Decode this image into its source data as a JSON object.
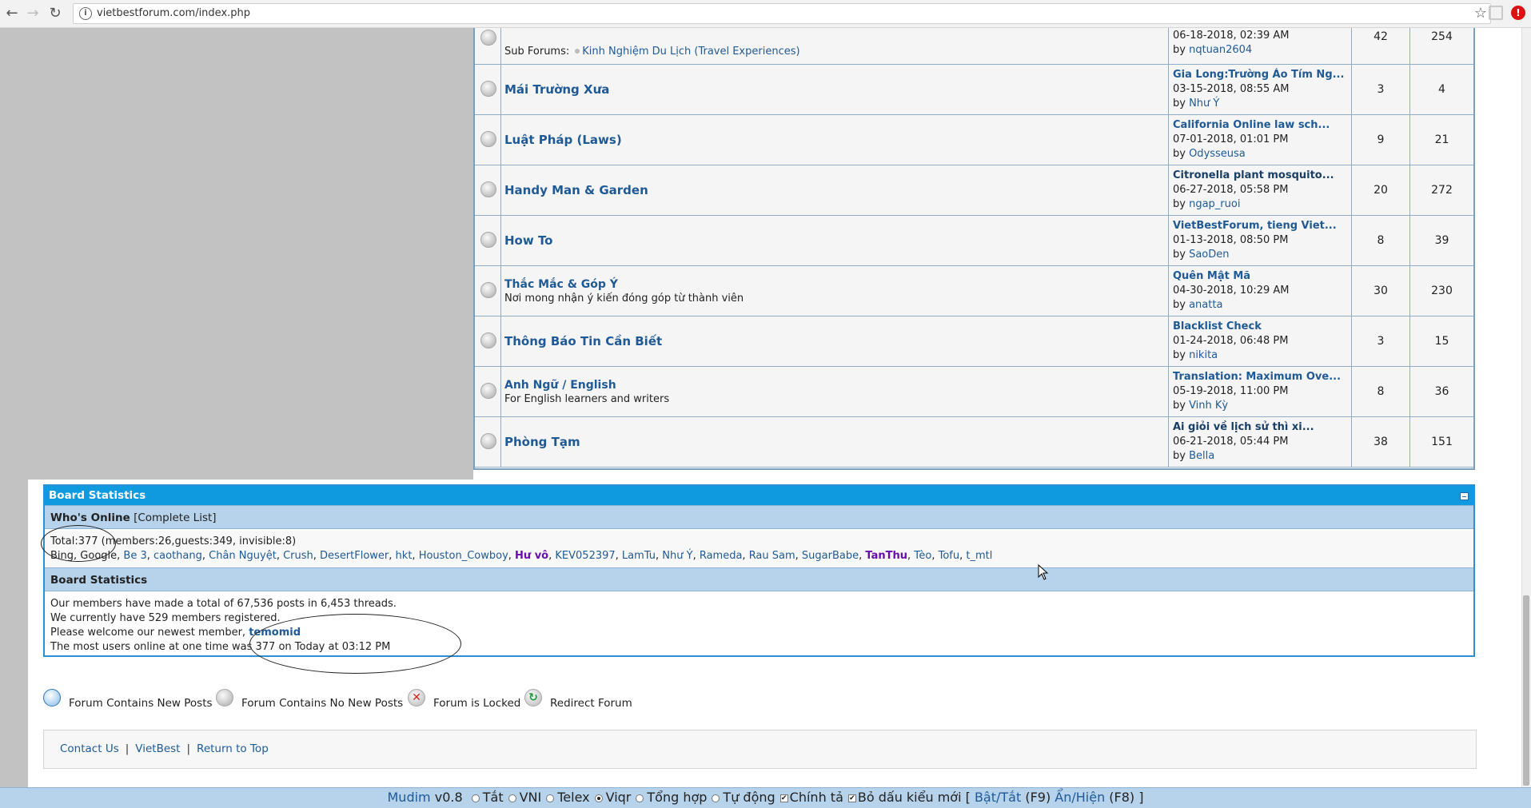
{
  "browser": {
    "url": "vietbestforum.com/index.php",
    "info_symbol": "i"
  },
  "forums": [
    {
      "name": "",
      "sub_forums_label": "Sub Forums:",
      "sub_forum": "Kinh Nghiệm Du Lịch (Travel Experiences)",
      "last_title": "",
      "last_date": "06-18-2018, 02:39 AM",
      "last_by": "nqtuan2604",
      "threads": "42",
      "posts": "254"
    },
    {
      "name": "Mái Trường Xưa",
      "desc": "",
      "last_title": "Gia Long:Trường Áo Tím Ng...",
      "last_date": "03-15-2018, 08:55 AM",
      "last_by": "Như Ý",
      "threads": "3",
      "posts": "4"
    },
    {
      "name": "Luật Pháp (Laws)",
      "desc": "",
      "last_title": "California Online law sch...",
      "last_date": "07-01-2018, 01:01 PM",
      "last_by": "Odysseusa",
      "threads": "9",
      "posts": "21"
    },
    {
      "name": "Handy Man & Garden",
      "desc": "",
      "last_title": "Citronella plant mosquito...",
      "last_date": "06-27-2018, 05:58 PM",
      "last_by": "ngap_ruoi",
      "threads": "20",
      "posts": "272"
    },
    {
      "name": "How To",
      "desc": "",
      "last_title": "VietBestForum, tieng Viet...",
      "last_date": "01-13-2018, 08:50 PM",
      "last_by": "SaoDen",
      "threads": "8",
      "posts": "39"
    },
    {
      "name": "Thắc Mắc & Góp Ý",
      "desc": "Nơi mong nhận ý kiến đóng góp từ thành viên",
      "last_title": "Quên Mật Mã",
      "last_date": "04-30-2018, 10:29 AM",
      "last_by": "anatta",
      "threads": "30",
      "posts": "230"
    },
    {
      "name": "Thông Báo Tin Cần Biết",
      "desc": "",
      "last_title": "Blacklist Check",
      "last_date": "01-24-2018, 06:48 PM",
      "last_by": "nikita",
      "threads": "3",
      "posts": "15"
    },
    {
      "name": "Anh Ngữ / English",
      "desc": "For English learners and writers",
      "last_title": "Translation: Maximum Ove...",
      "last_date": "05-19-2018, 11:00 PM",
      "last_by": "Vinh Kỳ",
      "threads": "8",
      "posts": "36"
    },
    {
      "name": "Phòng Tạm",
      "desc": "",
      "last_title": "Ai giỏi về lịch sử thì xi...",
      "last_date": "06-21-2018, 05:44 PM",
      "last_by": "Bella",
      "threads": "38",
      "posts": "151"
    }
  ],
  "by_prefix": "by ",
  "stats": {
    "header": "Board Statistics",
    "whos_online_label": "Who's Online",
    "complete_list": "[Complete List]",
    "total_line": "Total:377  (members:26,guests:349, invisible:8)",
    "online_prefix": "Bing, Google, ",
    "online_users": [
      {
        "n": "Be 3",
        "t": "u"
      },
      {
        "n": "caothang",
        "t": "u"
      },
      {
        "n": "Chân Nguyệt",
        "t": "u"
      },
      {
        "n": "Crush",
        "t": "u"
      },
      {
        "n": "DesertFlower",
        "t": "u"
      },
      {
        "n": "hkt",
        "t": "u"
      },
      {
        "n": "Houston_Cowboy",
        "t": "u"
      },
      {
        "n": "Hư vô",
        "t": "mod"
      },
      {
        "n": "KEV052397",
        "t": "u"
      },
      {
        "n": "LamTu",
        "t": "u"
      },
      {
        "n": "Như Ý",
        "t": "u"
      },
      {
        "n": "Rameda",
        "t": "u"
      },
      {
        "n": "Rau Sam",
        "t": "u"
      },
      {
        "n": "SugarBabe",
        "t": "u"
      },
      {
        "n": "TanThu",
        "t": "mod"
      },
      {
        "n": "Tèo",
        "t": "u"
      },
      {
        "n": "Tofu",
        "t": "u"
      },
      {
        "n": "t_mtl",
        "t": "u"
      }
    ],
    "board_stats_label": "Board Statistics",
    "line1": "Our members have made a total of 67,536 posts in 6,453 threads.",
    "line2": "We currently have 529 members registered.",
    "line3_prefix": "Please welcome our newest member, ",
    "newest_member": "temomid",
    "line4": "The most users online at one time was 377 on Today at 03:12 PM"
  },
  "legend": {
    "new_posts": "Forum Contains New Posts",
    "no_new_posts": "Forum Contains No New Posts",
    "locked": "Forum is Locked",
    "redirect": "Redirect Forum",
    "locked_glyph": "✕",
    "redirect_glyph": "↻"
  },
  "footer": {
    "contact": "Contact Us",
    "home": "VietBest",
    "top": "Return to Top",
    "sep": "|"
  },
  "mudim": {
    "brand": "Mudim",
    "version": " v0.8 ",
    "opt_off": "Tắt",
    "opt_vni": "VNI",
    "opt_telex": "Telex",
    "opt_viqr": "Viqr",
    "opt_combo": "Tổng hợp",
    "opt_auto": "Tự động",
    "spell": "Chính tả",
    "new_accent": "Bỏ dấu kiểu mới",
    "bracket_open": " [ ",
    "toggle": "Bật/Tắt",
    "toggle_key": " (F9) ",
    "show": "Ẩn/Hiện",
    "show_key": " (F8) ]",
    "check_glyph": "✔"
  }
}
